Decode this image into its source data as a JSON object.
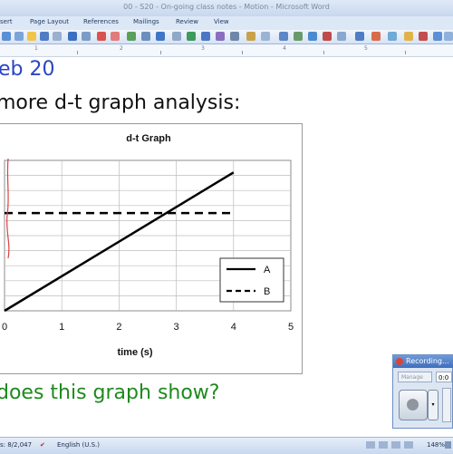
{
  "window": {
    "title": "00 - S20 - On-going class notes - Motion - Microsoft Word"
  },
  "menu": {
    "items": [
      "sert",
      "Page Layout",
      "References",
      "Mailings",
      "Review",
      "View"
    ]
  },
  "ruler": {
    "labels": [
      "1",
      "2",
      "3",
      "4",
      "5"
    ]
  },
  "document": {
    "heading": "eb 20",
    "subheading": "more d-t graph analysis:",
    "question": "does this graph show?"
  },
  "chart_data": {
    "type": "line",
    "title": "d-t Graph",
    "xlabel": "time (s)",
    "ylabel": "",
    "xlim": [
      0,
      5
    ],
    "ylim": [
      0,
      10
    ],
    "x_ticks": [
      "0",
      "1",
      "2",
      "3",
      "4",
      "5"
    ],
    "grid": true,
    "legend_position": "right",
    "series": [
      {
        "name": "A",
        "style": "solid",
        "x": [
          0,
          4
        ],
        "y": [
          0,
          9.2
        ]
      },
      {
        "name": "B",
        "style": "dashed",
        "x": [
          0,
          4
        ],
        "y": [
          6.5,
          6.5
        ]
      }
    ],
    "annotation_color": "#e04040"
  },
  "recorder": {
    "title": "Recording...",
    "source": "Manage",
    "time": "0:0"
  },
  "status": {
    "words": "s: 8/2,047",
    "language": "English (U.S.)",
    "zoom": "148%"
  },
  "colors": {
    "heading": "#2a45c4",
    "question": "#1e8a1e"
  }
}
